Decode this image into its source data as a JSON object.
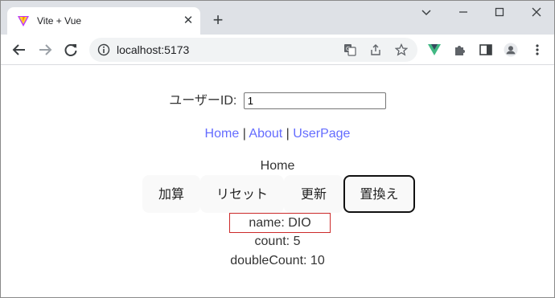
{
  "browser": {
    "tab_title": "Vite + Vue",
    "tab_close_glyph": "✕",
    "new_tab_glyph": "+",
    "url": "localhost:5173",
    "window_controls": {
      "minimize_glyph": "⌄",
      "restore_glyph": "—",
      "maximize_glyph": "☐",
      "close_glyph": "✕"
    }
  },
  "colors": {
    "link": "#646cff",
    "name_border": "#cc2a2a",
    "vue_green": "#41b883",
    "vue_dark": "#35495e"
  },
  "page": {
    "user_label": "ユーザーID:",
    "user_input_value": "1",
    "nav": {
      "home": "Home",
      "about": "About",
      "userpage": "UserPage",
      "separator": "|"
    },
    "heading": "Home",
    "buttons": {
      "add": "加算",
      "reset": "リセット",
      "update": "更新",
      "replace": "置換え"
    },
    "name_text": "name: DIO",
    "count_text": "count: 5",
    "double_count_text": "doubleCount: 10"
  }
}
